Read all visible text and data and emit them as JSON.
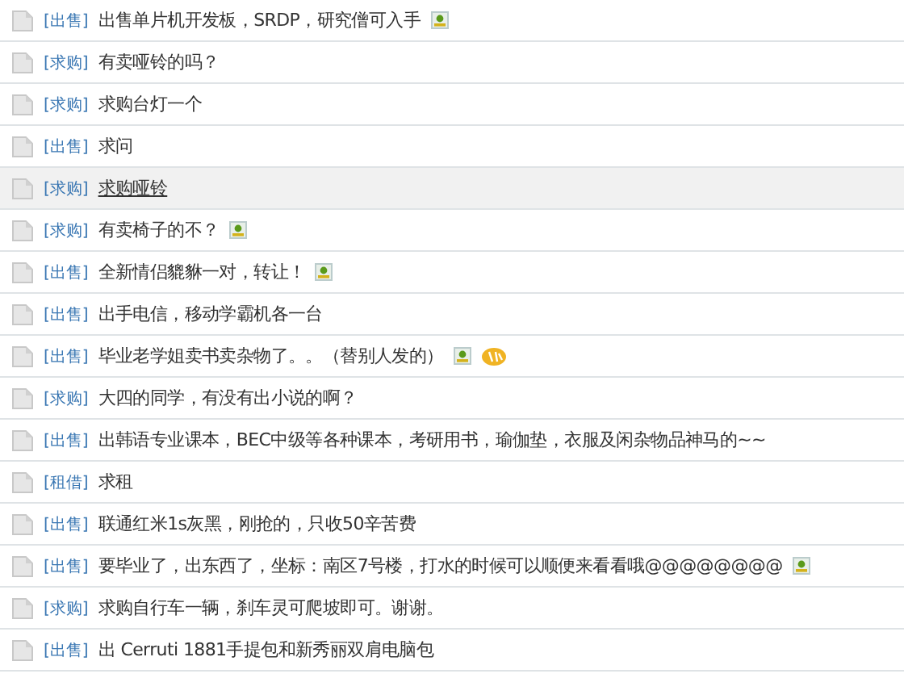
{
  "threads": [
    {
      "tag": "[出售]",
      "title": "出售单片机开发板，SRDP，研究僧可入手",
      "has_image": true,
      "hot": false,
      "hovered": false
    },
    {
      "tag": "[求购]",
      "title": "有卖哑铃的吗？",
      "has_image": false,
      "hot": false,
      "hovered": false
    },
    {
      "tag": "[求购]",
      "title": "求购台灯一个",
      "has_image": false,
      "hot": false,
      "hovered": false
    },
    {
      "tag": "[出售]",
      "title": "求问",
      "has_image": false,
      "hot": false,
      "hovered": false
    },
    {
      "tag": "[求购]",
      "title": "求购哑铃",
      "has_image": false,
      "hot": false,
      "hovered": true
    },
    {
      "tag": "[求购]",
      "title": "有卖椅子的不？",
      "has_image": true,
      "hot": false,
      "hovered": false
    },
    {
      "tag": "[出售]",
      "title": "全新情侣貔貅一对，转让！",
      "has_image": true,
      "hot": false,
      "hovered": false
    },
    {
      "tag": "[出售]",
      "title": "出手电信，移动学霸机各一台",
      "has_image": false,
      "hot": false,
      "hovered": false
    },
    {
      "tag": "[出售]",
      "title": "毕业老学姐卖书卖杂物了。。（替别人发的）",
      "has_image": true,
      "hot": true,
      "hovered": false
    },
    {
      "tag": "[求购]",
      "title": "大四的同学，有没有出小说的啊？",
      "has_image": false,
      "hot": false,
      "hovered": false
    },
    {
      "tag": "[出售]",
      "title": "出韩语专业课本，BEC中级等各种课本，考研用书，瑜伽垫，衣服及闲杂物品神马的~~",
      "has_image": false,
      "hot": false,
      "hovered": false
    },
    {
      "tag": "[租借]",
      "title": "求租",
      "has_image": false,
      "hot": false,
      "hovered": false
    },
    {
      "tag": "[出售]",
      "title": "联通红米1s灰黑，刚抢的，只收50辛苦费",
      "has_image": false,
      "hot": false,
      "hovered": false
    },
    {
      "tag": "[出售]",
      "title": "要毕业了，出东西了，坐标：南区7号楼，打水的时候可以顺便来看看哦@@@@@@@@",
      "has_image": true,
      "hot": false,
      "hovered": false
    },
    {
      "tag": "[求购]",
      "title": "求购自行车一辆，刹车灵可爬坡即可。谢谢。",
      "has_image": false,
      "hot": false,
      "hovered": false
    },
    {
      "tag": "[出售]",
      "title": "出 Cerruti 1881手提包和新秀丽双肩电脑包",
      "has_image": false,
      "hot": false,
      "hovered": false
    }
  ]
}
